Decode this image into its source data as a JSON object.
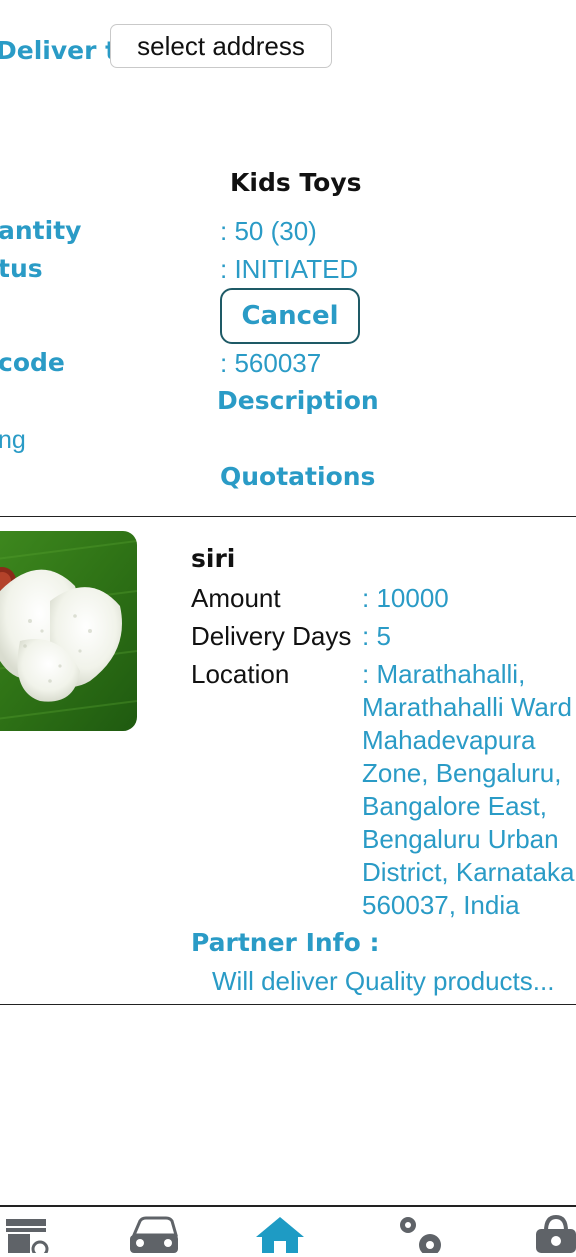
{
  "header": {
    "deliver_label": "Deliver to",
    "address_button": "select address"
  },
  "product": {
    "title": "Kids Toys",
    "quantity_label": "antity",
    "quantity_value": ": 50 (30)",
    "status_label": "tus",
    "status_value": ": INITIATED",
    "cancel_label": "Cancel",
    "pincode_label": "code",
    "pincode_value": ": 560037",
    "description_link": "Description",
    "partial_label": "ng",
    "quotations_link": "Quotations"
  },
  "quotation": {
    "vendor": "siri",
    "amount_label": "Amount",
    "amount_value": ": 10000",
    "delivery_days_label": "Delivery Days",
    "delivery_days_value": ": 5",
    "location_label": "Location",
    "location_value": ": Marathahalli, Marathahalli Ward Mahadevapura Zone, Bengaluru, Bangalore East, Bengaluru Urban District, Karnataka 560037, India",
    "partner_info_label": "Partner Info :",
    "partner_info_text": "Will deliver Quality products..."
  },
  "nav": {
    "items": [
      "shop-icon",
      "car-icon",
      "home-icon",
      "settings-icon",
      "bag-icon"
    ],
    "active": "home-icon"
  },
  "colors": {
    "accent": "#2a9bc6",
    "active_nav": "#1e9bc4",
    "nav_icon": "#5f6368"
  }
}
